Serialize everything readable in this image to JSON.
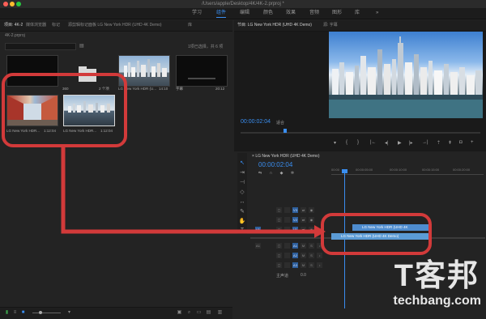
{
  "window": {
    "title": "/Users/apple/Desktop/4K/4K-2.prproj *",
    "menu": [
      "学习",
      "组件",
      "编辑",
      "颜色",
      "效果",
      "音频",
      "图形",
      "库"
    ]
  },
  "project_panel": {
    "tabs": [
      "项目: 4K-2",
      "媒体浏览器",
      "标记",
      "源剪辑标记面板 LG New York HDR (UHD 4K Demo)",
      "库"
    ],
    "project_name": "4K-2.prproj",
    "selection_info": "1项已选择，共 6 项",
    "row_labels": [
      {
        "name": "360",
        "info": "2 个项"
      },
      {
        "name": "LG New York HDR (U...",
        "info": "14:10"
      },
      {
        "name": "字幕",
        "info": "20:12"
      }
    ],
    "cards": [
      {
        "name": "LG New York HDR...",
        "duration": "1:12:04"
      },
      {
        "name": "LG New York HDR...",
        "duration": "1:12:04"
      }
    ]
  },
  "program_monitor": {
    "tabs": [
      "节目: LG New York HDR (UHD 4K Demo)",
      "源: 字幕"
    ],
    "timecode": "00:00:02:04",
    "fit": "适合"
  },
  "timeline": {
    "sequence_tab": "LG New York HDR (UHD 4K Demo)",
    "timecode": "00:00:02:04",
    "ruler": [
      "00:00",
      "00:00:05:00",
      "00:00:10:00",
      "00:00:15:00",
      "00:00:20:00"
    ],
    "tracks": [
      "V3",
      "V2",
      "V1",
      "A1",
      "A2",
      "A3"
    ],
    "mix_label": "主声道",
    "clips": [
      {
        "name": "LG New York HDR (UHD 4K"
      },
      {
        "name": "LG New York HDR (UHD 4K Demo)"
      }
    ]
  },
  "watermark": {
    "cn": "T客邦",
    "en": "techbang.com"
  },
  "colors": {
    "accent": "#3a8ef0",
    "highlight": "#d23a3a",
    "clip": "#5b9bd5"
  }
}
